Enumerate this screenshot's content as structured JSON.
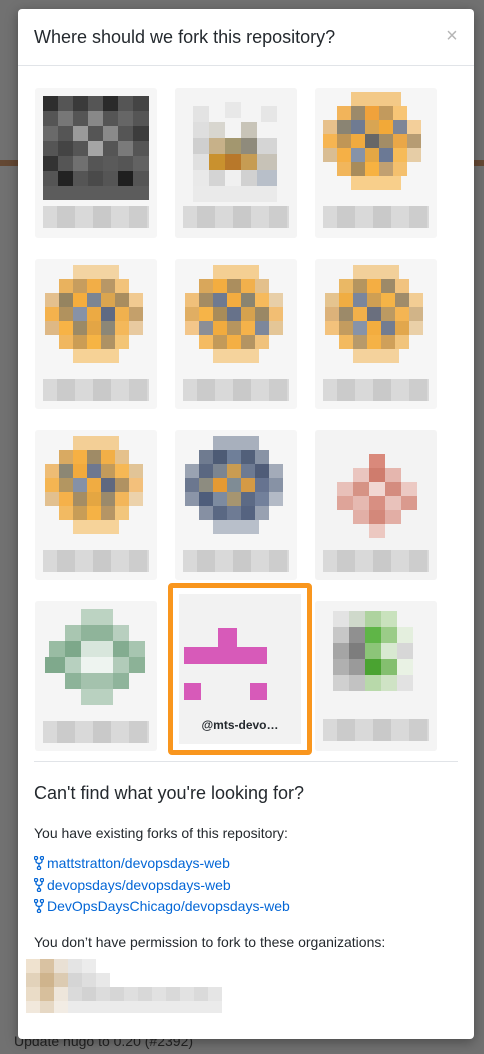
{
  "modal": {
    "title": "Where should we fork this repository?",
    "close_icon": "×"
  },
  "tiles": [
    {
      "name": "tile-account-1",
      "label": ""
    },
    {
      "name": "tile-account-2",
      "label": ""
    },
    {
      "name": "tile-account-3",
      "label": ""
    },
    {
      "name": "tile-account-4",
      "label": ""
    },
    {
      "name": "tile-account-5",
      "label": ""
    },
    {
      "name": "tile-account-6",
      "label": ""
    },
    {
      "name": "tile-account-7",
      "label": ""
    },
    {
      "name": "tile-account-8",
      "label": ""
    },
    {
      "name": "tile-account-9",
      "label": ""
    },
    {
      "name": "tile-account-10",
      "label": ""
    },
    {
      "name": "tile-mts-devo",
      "label": "@mts-devo…",
      "selected": true
    },
    {
      "name": "tile-account-12",
      "label": ""
    }
  ],
  "cant_find": {
    "title": "Can't find what you're looking for?",
    "existing_label": "You have existing forks of this repository:",
    "forks": [
      "mattstratton/devopsdays-web",
      "devopsdays/devopsdays-web",
      "DevOpsDaysChicago/devopsdays-web"
    ],
    "no_permission_label": "You don’t have permission to fork to these organizations:"
  },
  "background": {
    "footer_text": "Update hugo to 0.20 (#2392)"
  },
  "colors": {
    "selected_border": "#f9961e",
    "link": "#0366d6",
    "mts_identicon": "#d75ab9"
  }
}
